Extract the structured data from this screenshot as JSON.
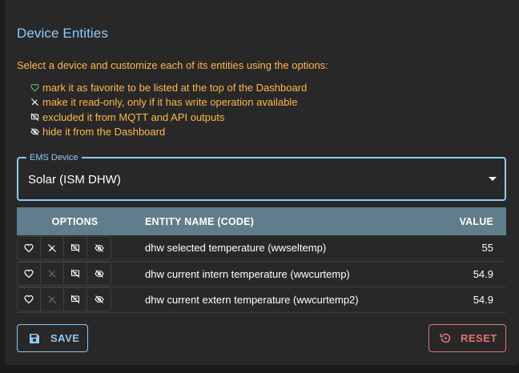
{
  "title": "Device Entities",
  "intro": "Select a device and customize each of its entities using the options:",
  "options_help": [
    {
      "icon": "heart-icon",
      "color": "#66bb6a",
      "text": "mark it as favorite to be listed at the top of the Dashboard"
    },
    {
      "icon": "edit-off-icon",
      "color": "#ffffff",
      "text": "make it read-only, only if it has write operation available"
    },
    {
      "icon": "comments-disabled-icon",
      "color": "#ffffff",
      "text": "excluded it from MQTT and API outputs"
    },
    {
      "icon": "visibility-off-icon",
      "color": "#ffffff",
      "text": "hide it from the Dashboard"
    }
  ],
  "device_select": {
    "label": "EMS Device",
    "value": "Solar (ISM DHW)"
  },
  "table": {
    "headers": {
      "options": "OPTIONS",
      "name": "ENTITY NAME (CODE)",
      "value": "VALUE"
    },
    "rows": [
      {
        "name": "dhw selected temperature (wwseltemp)",
        "value": "55",
        "readonly_enabled": true
      },
      {
        "name": "dhw current intern temperature (wwcurtemp)",
        "value": "54.9",
        "readonly_enabled": false
      },
      {
        "name": "dhw current extern temperature (wwcurtemp2)",
        "value": "54.9",
        "readonly_enabled": false
      }
    ]
  },
  "buttons": {
    "save": "SAVE",
    "reset": "RESET"
  },
  "colors": {
    "accent": "#90caf9",
    "warning": "#ffb74d",
    "error": "#e57373",
    "table_header": "#607d8b"
  }
}
